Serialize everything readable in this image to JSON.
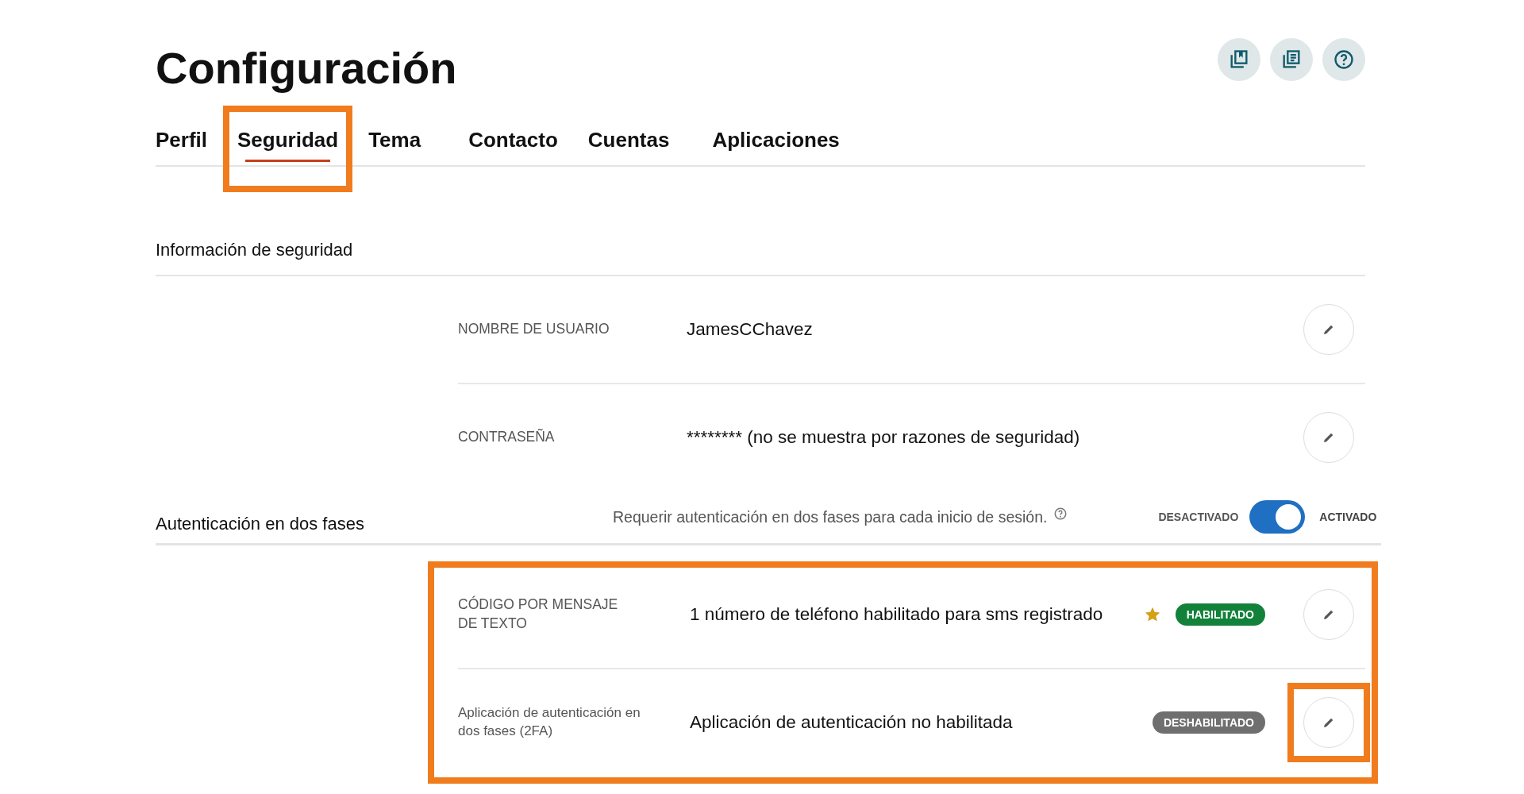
{
  "title": "Configuración",
  "tabs": [
    {
      "label": "Perfil",
      "selected": false,
      "highlighted": false
    },
    {
      "label": "Seguridad",
      "selected": true,
      "highlighted": true
    },
    {
      "label": "Tema",
      "selected": false,
      "highlighted": false
    },
    {
      "label": "Contacto",
      "selected": false,
      "highlighted": false
    },
    {
      "label": "Cuentas",
      "selected": false,
      "highlighted": false
    },
    {
      "label": "Aplicaciones",
      "selected": false,
      "highlighted": false
    }
  ],
  "security_info": {
    "heading": "Información de seguridad",
    "rows": [
      {
        "label": "NOMBRE DE USUARIO",
        "value": "JamesCChavez"
      },
      {
        "label": "CONTRASEÑA",
        "value": "******** (no se muestra por razones de seguridad)"
      }
    ]
  },
  "two_factor": {
    "heading": "Autenticación en dos fases",
    "description": "Requerir autenticación en dos fases para cada inicio de sesión.",
    "off_label": "DESACTIVADO",
    "on_label": "ACTIVADO",
    "on": true,
    "highlighted": true,
    "methods": [
      {
        "label": "CÓDIGO POR MENSAJE DE TEXTO",
        "value": "1 número de teléfono habilitado para sms registrado",
        "starred": true,
        "status": "HABILITADO",
        "kind": "enabled",
        "edit_highlighted": false
      },
      {
        "label": "Aplicación de autenticación en dos fases (2FA)",
        "value": "Aplicación de autenticación no habilitada",
        "starred": false,
        "status": "DESHABILITADO",
        "kind": "disabled",
        "edit_highlighted": true
      }
    ]
  }
}
